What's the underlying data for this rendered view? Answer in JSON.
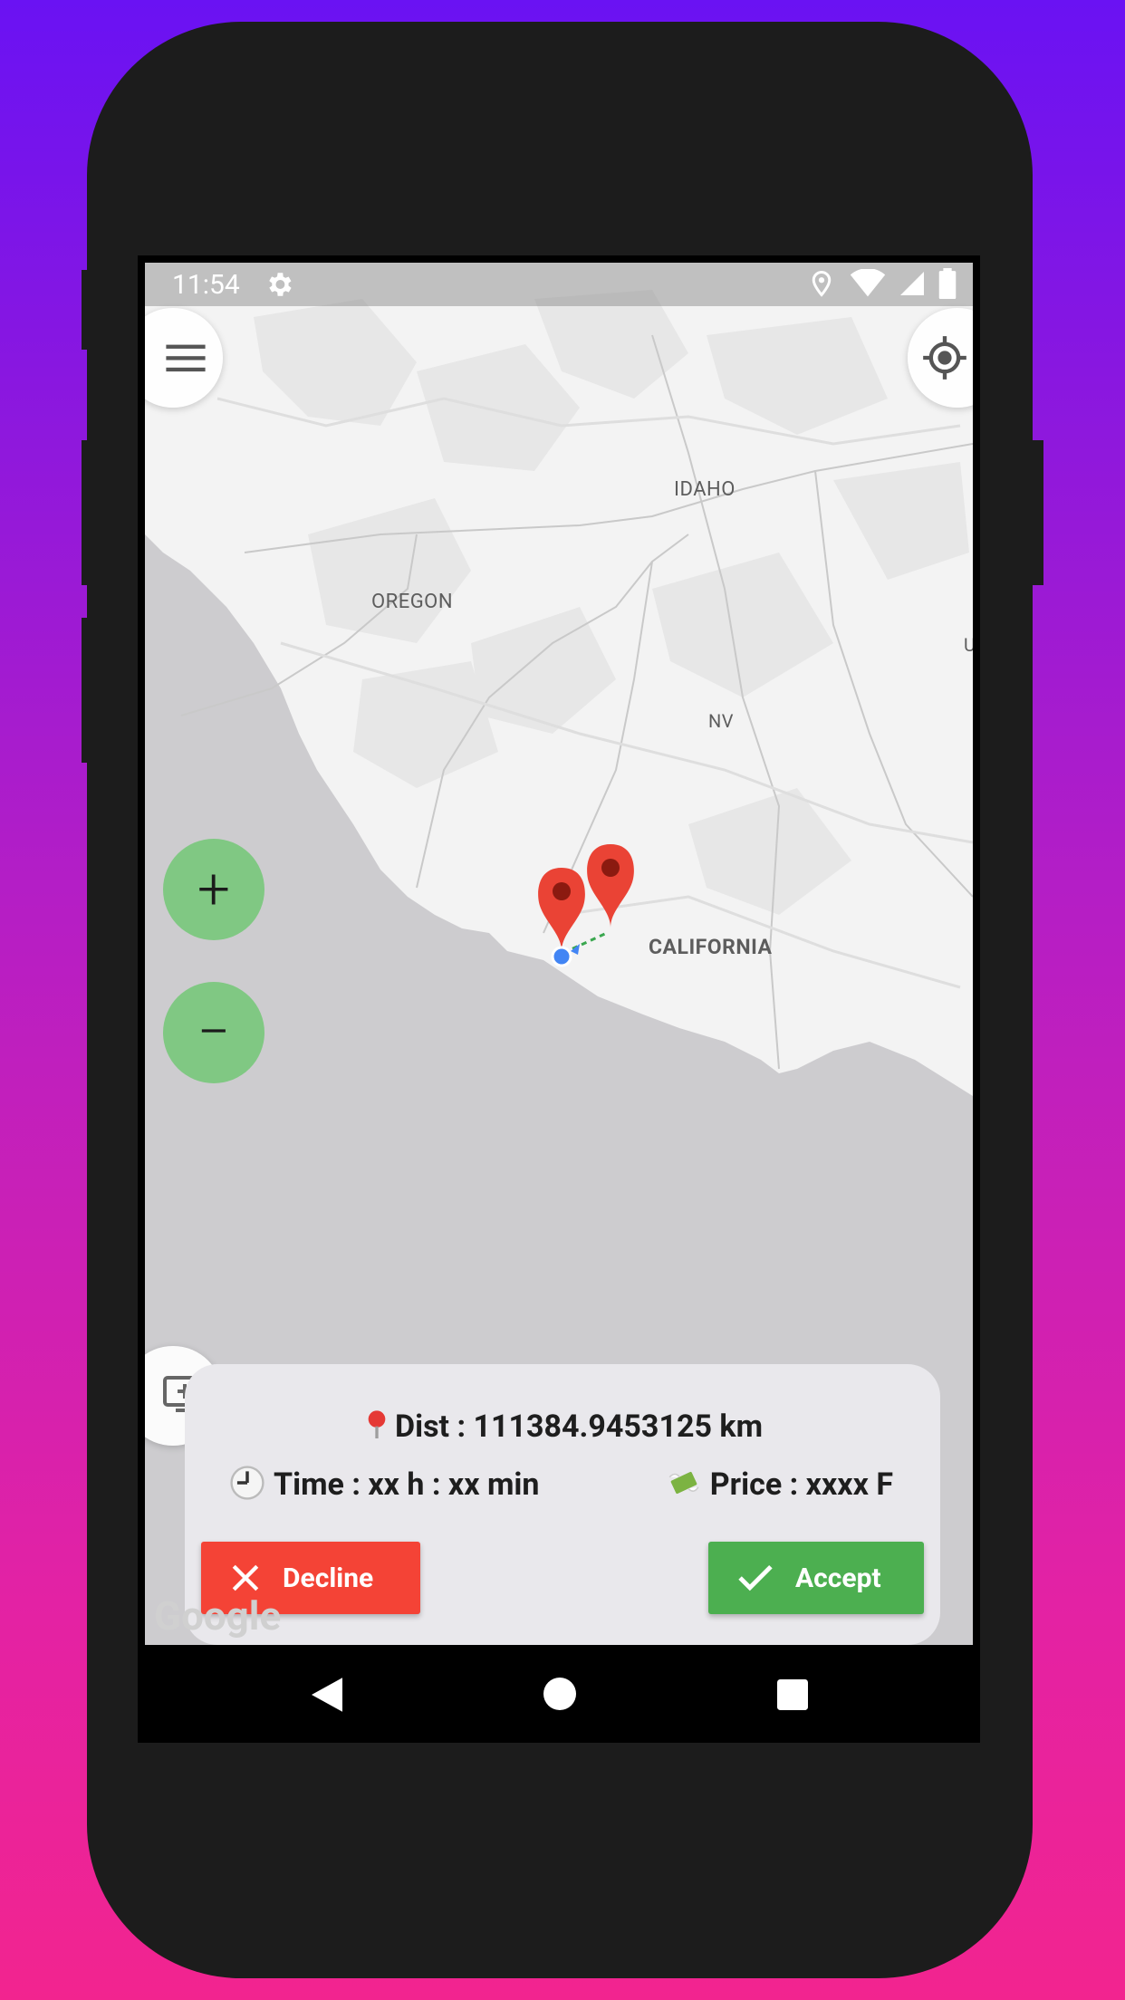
{
  "status_bar": {
    "time": "11:54",
    "icons": [
      "gear-icon",
      "location-icon",
      "wifi-icon",
      "signal-icon",
      "battery-icon"
    ]
  },
  "map": {
    "labels": {
      "idaho": "IDAHO",
      "oregon": "OREGON",
      "nevada": "NV",
      "california": "CALIFORNIA",
      "utah_partial": "U"
    },
    "controls": {
      "menu_icon": "menu-icon",
      "locate_icon": "crosshair-icon",
      "zoom_in": "+",
      "zoom_out": "−",
      "toggle_icon": "add-to-screen-icon"
    },
    "attribution": "Google"
  },
  "ride_card": {
    "distance": "Dist : 111384.9453125 km",
    "time": "Time : xx h : xx min",
    "price": "Price : xxxx F",
    "decline_label": "Decline",
    "accept_label": "Accept"
  },
  "colors": {
    "zoom_button": "#80c883",
    "decline": "#f44336",
    "accept": "#4caf50",
    "marker": "#ea4335"
  }
}
